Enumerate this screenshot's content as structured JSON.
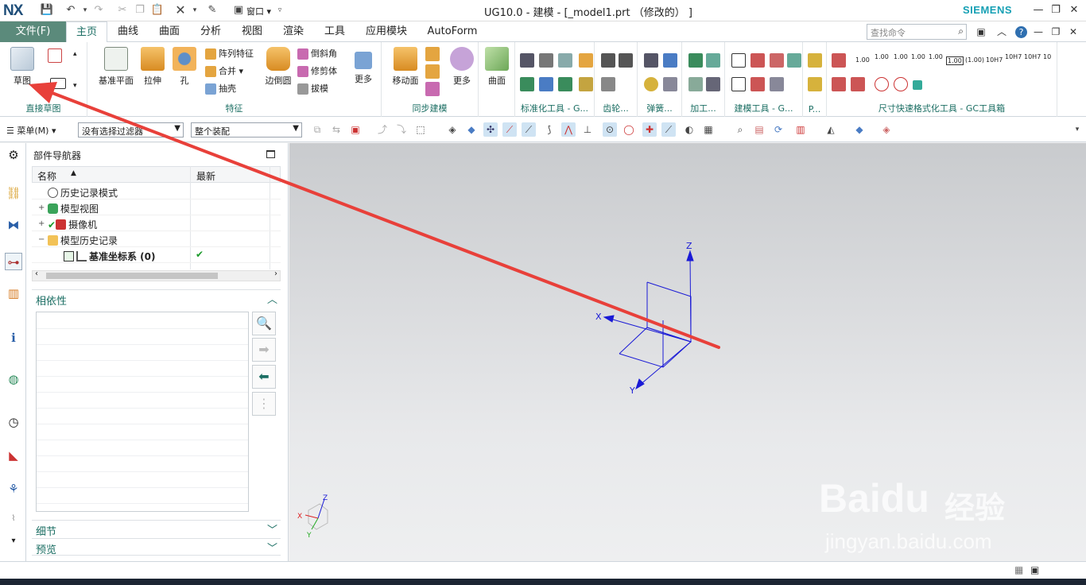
{
  "app": {
    "logo": "NX",
    "window_title": "UG10.0 - 建模 - [_model1.prt （修改的） ]",
    "brand": "SIEMENS",
    "window_menu": "窗口"
  },
  "menu": {
    "file": "文件(F)",
    "tabs": [
      "主页",
      "曲线",
      "曲面",
      "分析",
      "视图",
      "渲染",
      "工具",
      "应用模块",
      "AutoForm"
    ],
    "active_tab": "主页",
    "search_placeholder": "查找命令"
  },
  "ribbon": {
    "sketch": {
      "label": "草图",
      "group": "直接草图"
    },
    "feature": {
      "datum_plane": "基准平面",
      "extrude": "拉伸",
      "hole": "孔",
      "pattern": "阵列特征",
      "unite": "合并",
      "shell": "抽壳",
      "edge_blend": "边倒圆",
      "chamfer": "倒斜角",
      "trim_body": "修剪体",
      "draft": "拔模",
      "more": "更多",
      "group": "特征"
    },
    "sync": {
      "move_face": "移动面",
      "more": "更多",
      "group": "同步建模"
    },
    "surface": {
      "label": "曲面"
    },
    "groups": [
      "标准化工具 - G...",
      "齿轮...",
      "弹簧...",
      "加工...",
      "建模工具 - G...",
      "P...",
      "尺寸快速格式化工具 - GC工具箱"
    ],
    "dim_labels": [
      "1.00",
      "1.00",
      "1.00",
      "1.00",
      "1.00",
      "1.00",
      "(1.00)",
      "10H7",
      "10H7",
      "10H7",
      "10"
    ]
  },
  "toolbar2": {
    "menu": "菜单(M)",
    "filter": "没有选择过滤器",
    "assembly": "整个装配"
  },
  "navigator": {
    "title": "部件导航器",
    "columns": [
      "名称",
      "最新"
    ],
    "rows": [
      {
        "name": "历史记录模式",
        "icon": "clock-icon"
      },
      {
        "name": "模型视图",
        "icon": "views-icon"
      },
      {
        "name": "摄像机",
        "icon": "camera-icon"
      },
      {
        "name": "模型历史记录",
        "icon": "folder-icon"
      },
      {
        "name": "基准坐标系 (0)",
        "icon": "datum-csys-icon",
        "status": "✔"
      }
    ],
    "sections": {
      "dependency": "相依性",
      "details": "细节",
      "preview": "预览"
    }
  },
  "axes": {
    "x": "X",
    "y": "Y",
    "z": "Z"
  },
  "watermark": {
    "brand": "Baidu",
    "cn": "经验",
    "url": "jingyan.baidu.com"
  },
  "colors": {
    "accent": "#1b6e63",
    "file_tab": "#5b8a7b",
    "arrow": "#e8403a",
    "csys": "#1a1ad6"
  }
}
